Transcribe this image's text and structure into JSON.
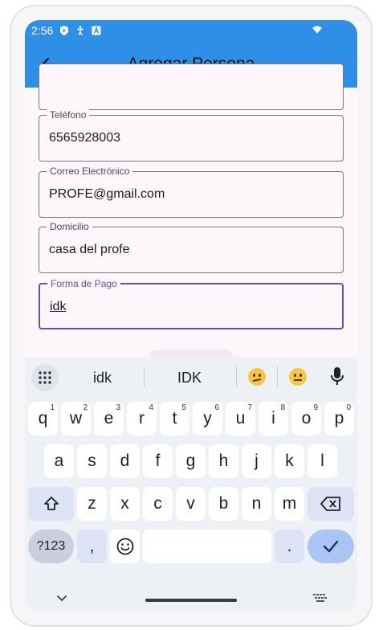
{
  "status_bar": {
    "time": "2:56"
  },
  "app_bar": {
    "title": "Agregar Persona"
  },
  "form": {
    "fields": [
      {
        "label": "Teléfono",
        "value": "6565928003"
      },
      {
        "label": "Correo Electrónico",
        "value": "PROFE@gmail.com"
      },
      {
        "label": "Domicilio",
        "value": "casa del profe"
      },
      {
        "label": "Forma de Pago",
        "value": "idk"
      }
    ]
  },
  "keyboard": {
    "suggestions": [
      "idk",
      "IDK"
    ],
    "emoji_suggestions": [
      "confused-face",
      "neutral-face"
    ],
    "row1": [
      {
        "key": "q",
        "sup": "1"
      },
      {
        "key": "w",
        "sup": "2"
      },
      {
        "key": "e",
        "sup": "3"
      },
      {
        "key": "r",
        "sup": "4"
      },
      {
        "key": "t",
        "sup": "5"
      },
      {
        "key": "y",
        "sup": "6"
      },
      {
        "key": "u",
        "sup": "7"
      },
      {
        "key": "i",
        "sup": "8"
      },
      {
        "key": "o",
        "sup": "9"
      },
      {
        "key": "p",
        "sup": "0"
      }
    ],
    "row2": [
      "a",
      "s",
      "d",
      "f",
      "g",
      "h",
      "j",
      "k",
      "l"
    ],
    "row3": [
      "z",
      "x",
      "c",
      "v",
      "b",
      "n",
      "m"
    ],
    "symbols_label": "?123",
    "comma": ",",
    "period": "."
  }
}
